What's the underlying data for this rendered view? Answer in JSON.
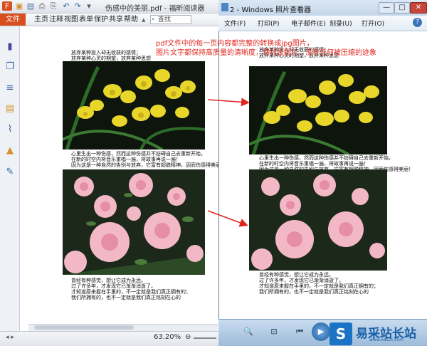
{
  "reader": {
    "title": "伤感中的美丽.pdf - 福昕阅读器",
    "quick_access": [
      "F",
      "▣",
      "▤",
      "⎙",
      "⎘",
      "↶",
      "↷",
      "▾"
    ],
    "menu": {
      "file": "文件",
      "items": [
        "主页",
        "注释",
        "视图",
        "表单",
        "保护",
        "共享",
        "帮助"
      ]
    },
    "search_placeholder": "查找",
    "zoom": "63.20%",
    "zoom_minus": "⊖",
    "doc": {
      "para_top": [
        "放弃某种投入却无收获的感情；",
        "放弃某种心灵的期望，放弃某种思想"
      ],
      "para_mid": [
        "心里生出一种伤感，然而这种伤感并不妨碍自己去重新开始，",
        "在新的时空内将音乐重唱一遍，将故事再说一遍！",
        "因为这是一种自然的告别与放弃，它富有超脱精神，因而伤感得美丽！"
      ],
      "para_bottom": [
        "曾经有种感觉，想让它成为永远。",
        "过了许多年，才发现它已渐渐消逝了。",
        "才知道原来握在手里的，不一定就是我们真正拥有的；",
        "我们所拥有的，也不一定就是我们真正铭刻在心的"
      ]
    }
  },
  "viewer": {
    "title": "2 - Windows 照片查看器",
    "window_buttons": [
      "—",
      "□",
      "✕"
    ],
    "menu": [
      "文件(F)",
      "打印(P)",
      "电子邮件(E)",
      "刻录(U)",
      "打开(O)"
    ],
    "help_icon": "?",
    "toolbar": [
      "🔍",
      "⊡",
      "⏮",
      "▶",
      "⏭"
    ]
  },
  "annotation": {
    "line1": "pdf文件中的每一页内容都完整的转换成jpg图片，",
    "line2": "图片文字都保持高质量的清晰度，特别是图片，没有任何被压缩的迹象"
  },
  "watermark": {
    "logo": "S",
    "text": "易采站长站",
    "url": "www.easck.com"
  },
  "colors": {
    "annotation": "#e0271d",
    "file_menu": "#d94e1f",
    "viewer_chrome": "#c4d6ea",
    "watermark": "#1a5fa8"
  }
}
